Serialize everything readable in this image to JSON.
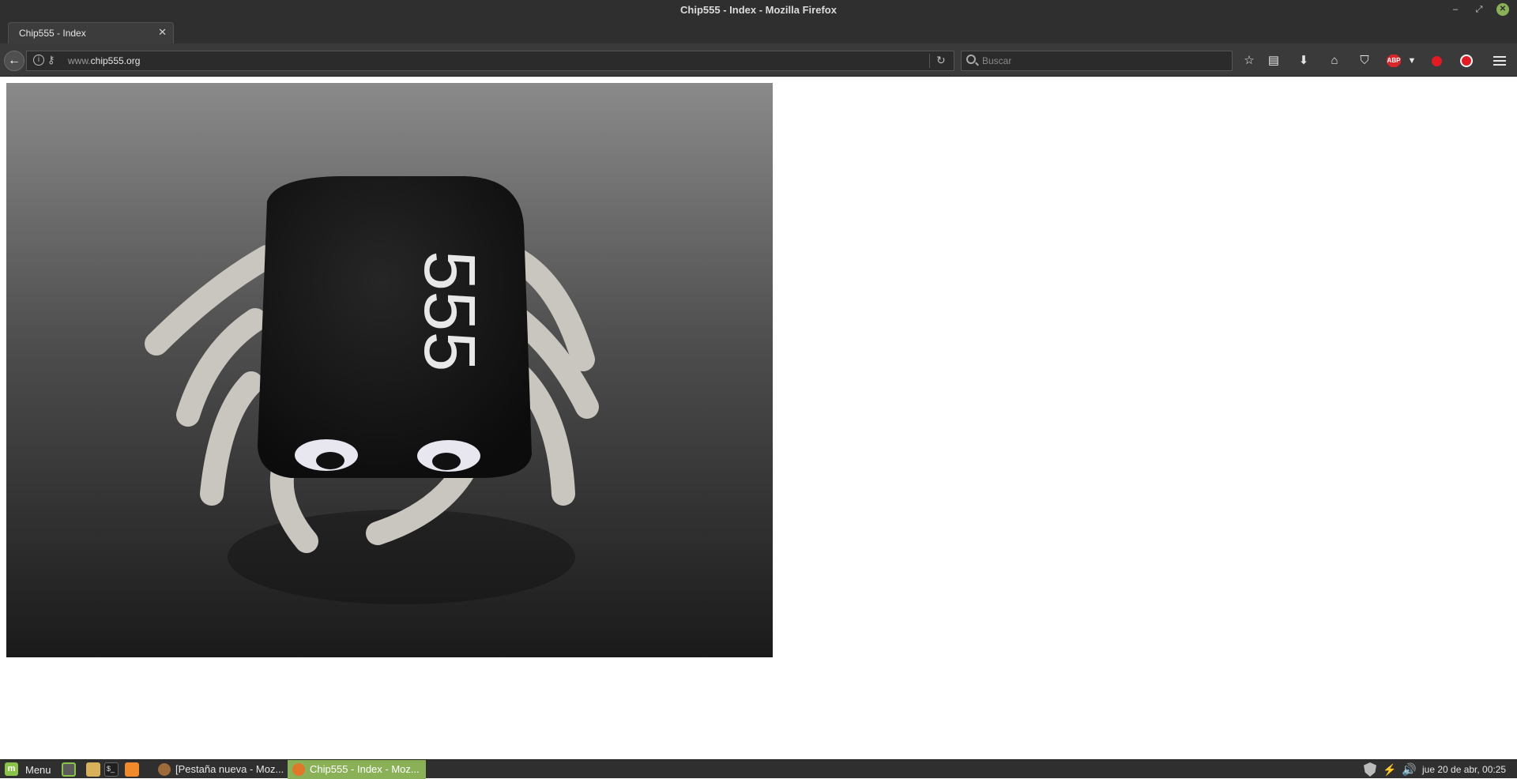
{
  "window": {
    "title": "Chip555 - Index - Mozilla Firefox",
    "controls": {
      "minimize": "–",
      "maximize": "⤢",
      "close": "✕"
    }
  },
  "tabs": [
    {
      "label": "Chip555 - Index",
      "active": true
    }
  ],
  "navbar": {
    "url_prefix": "www.",
    "url_domain": "chip555.org",
    "search_placeholder": "Buscar",
    "abp_label": "ABP"
  },
  "content": {
    "image_text": "555",
    "image_alt": "555"
  },
  "taskbar": {
    "menu_label": "Menu",
    "tasks": [
      {
        "label": "[Pestaña nueva - Moz...",
        "active": false
      },
      {
        "label": "Chip555 - Index - Moz...",
        "active": true
      }
    ],
    "clock": "jue 20 de abr, 00:25"
  },
  "colors": {
    "chrome_dark": "#2f2f2f",
    "toolbar": "#3a3a3a",
    "mint_accent": "#8bb158",
    "abp_red": "#d8262b"
  }
}
